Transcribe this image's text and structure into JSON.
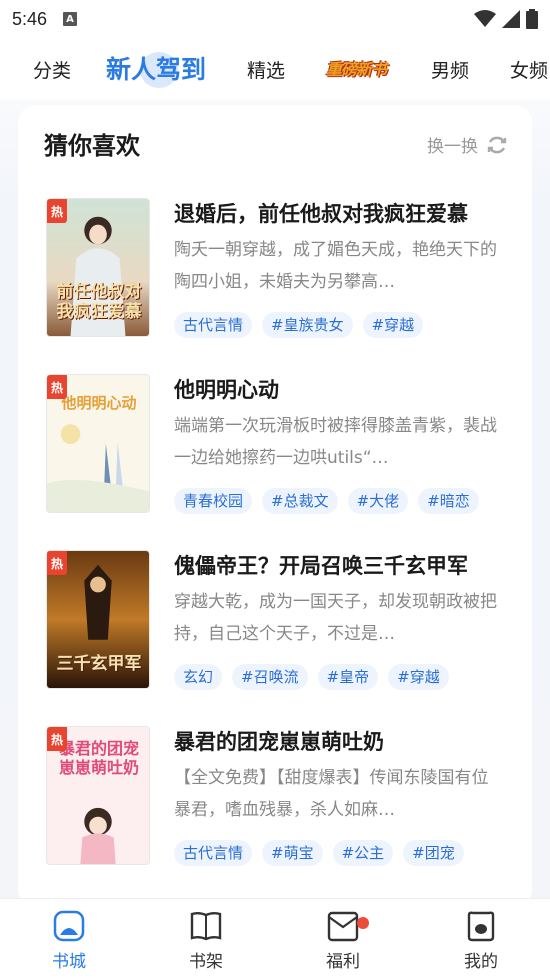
{
  "status_bar": {
    "time": "5:46",
    "notification_icon": "A"
  },
  "tabs": [
    {
      "label": "分类",
      "active": false
    },
    {
      "label": "新人驾到",
      "active": true
    },
    {
      "label": "精选",
      "active": false
    },
    {
      "label": "重磅新书",
      "active": false,
      "is_logo": true
    },
    {
      "label": "男频",
      "active": false
    },
    {
      "label": "女频",
      "active": false
    }
  ],
  "section": {
    "title": "猜你喜欢",
    "refresh_label": "换一换"
  },
  "hot_badge": "热",
  "books": [
    {
      "title": "退婚后，前任他叔对我疯狂爱慕",
      "description": "陶夭一朝穿越，成了媚色天成，艳绝天下的陶四小姐，未婚夫为另攀高…",
      "tags": [
        "古代言情",
        "#皇族贵女",
        "#穿越"
      ],
      "cover_text": "前任他叔对我疯狂爱慕"
    },
    {
      "title": "他明明心动",
      "description": "端端第一次玩滑板时被摔得膝盖青紫，裴战一边给她擦药一边哄utils“…",
      "tags": [
        "青春校园",
        "#总裁文",
        "#大佬",
        "#暗恋"
      ],
      "cover_text": "他明明心动"
    },
    {
      "title": "傀儡帝王？开局召唤三千玄甲军",
      "description": "穿越大乾，成为一国天子，却发现朝政被把持，自己这个天子，不过是…",
      "tags": [
        "玄幻",
        "#召唤流",
        "#皇帝",
        "#穿越"
      ],
      "cover_text": "三千玄甲军"
    },
    {
      "title": "暴君的团宠崽崽萌吐奶",
      "description": "【全文免费】【甜度爆表】传闻东陵国有位暴君，嗜血残暴，杀人如麻…",
      "tags": [
        "古代言情",
        "#萌宝",
        "#公主",
        "#团宠"
      ],
      "cover_text": "暴君的团宠崽崽萌吐奶"
    }
  ],
  "bottom_nav": [
    {
      "label": "书城",
      "icon": "home-icon",
      "active": true
    },
    {
      "label": "书架",
      "icon": "bookshelf-icon",
      "active": false
    },
    {
      "label": "福利",
      "icon": "gift-icon",
      "active": false,
      "has_dot": true
    },
    {
      "label": "我的",
      "icon": "profile-icon",
      "active": false
    }
  ],
  "colors": {
    "accent": "#2a7be4",
    "tag_text": "#2b6fd6",
    "tag_bg": "#eef4fd",
    "hot_badge": "#e8442f",
    "notification_dot": "#f04a3a"
  }
}
